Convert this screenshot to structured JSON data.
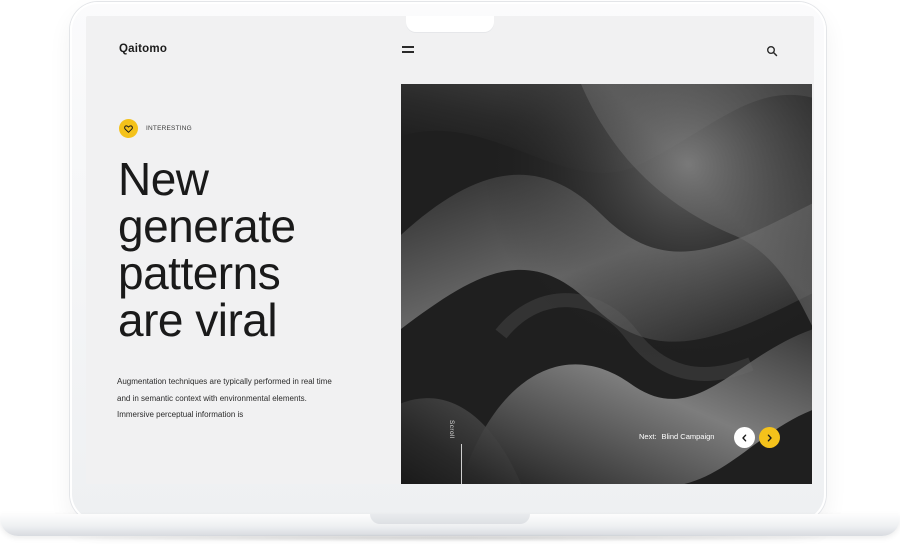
{
  "brand": "Qaitomo",
  "nav": {
    "menu_icon": "hamburger-menu-icon",
    "search_icon": "search-icon"
  },
  "tag": {
    "icon": "heart-icon",
    "label": "INTERESTING",
    "color": "#f4c21b"
  },
  "headline": [
    "New",
    "generate",
    "patterns",
    "are viral"
  ],
  "body_text": "Augmentation techniques are typically performed in real time and in semantic context with environmental elements. Immersive perceptual information is",
  "hero": {
    "scroll_label": "Scroll",
    "next_prefix": "Next:",
    "next_title": "Blind Campaign",
    "prev_icon": "chevron-left-icon",
    "next_icon": "chevron-right-icon"
  },
  "colors": {
    "accent": "#f4c21b",
    "background": "#f1f1f2",
    "hero": "#1e1e1e",
    "text": "#1a1a1a"
  }
}
